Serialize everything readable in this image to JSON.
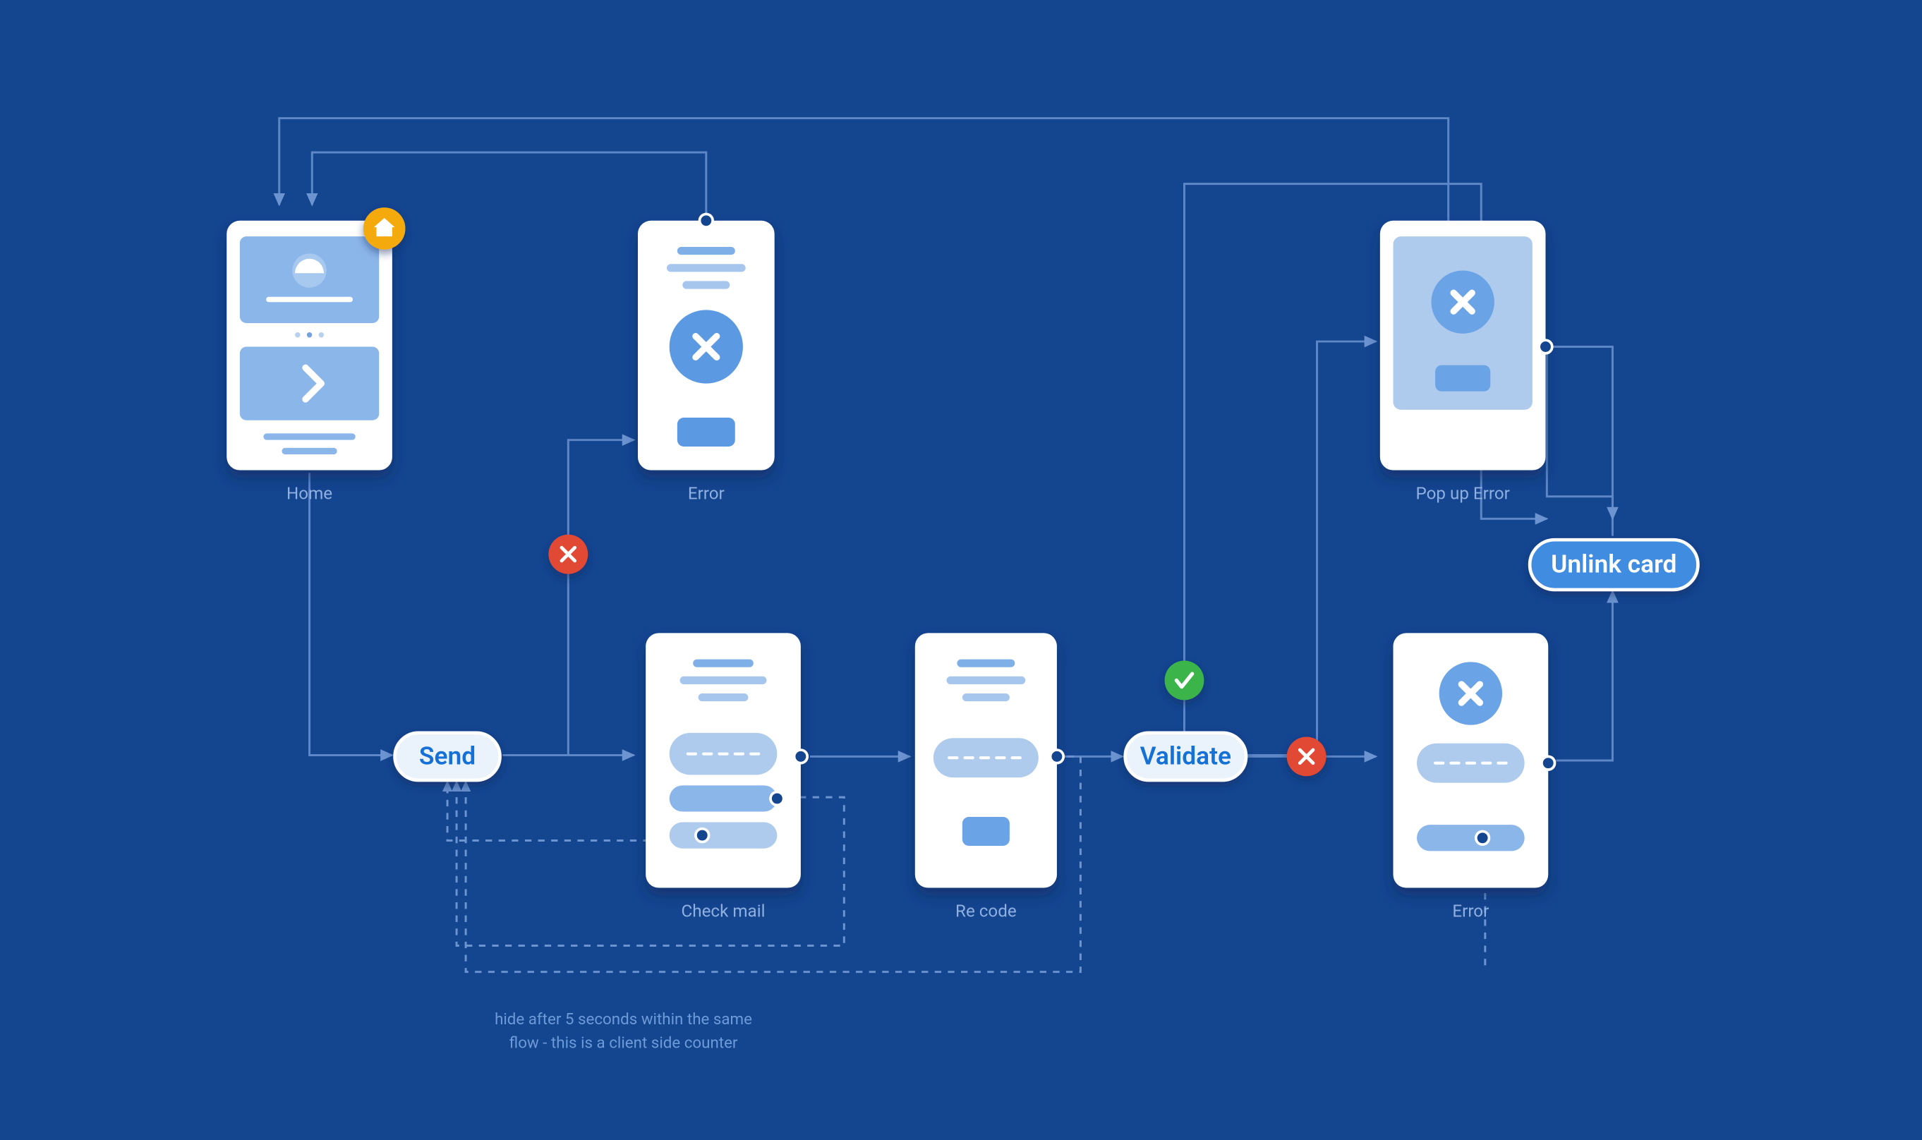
{
  "canvas": {
    "bg": "#14458f"
  },
  "palette": {
    "cardFill": "#ffffff",
    "cardAccent": "#6ba8ea",
    "cardAccentLight": "#a3c6ee",
    "cardAccentDark": "#4c93e2",
    "pillFill": "#eaf2fb",
    "pillBorder": "#ffffff",
    "pillAccent": "#1571d6",
    "pillSolid": "#3f8ce0",
    "badgeHome": "#f4a911",
    "badgeFail": "#e14a34",
    "badgeOk": "#3bb54a",
    "edge": "#4f7bc0",
    "edgeDash": "#5c88c8"
  },
  "screens": {
    "home": {
      "label": "Home"
    },
    "error_top": {
      "label": "Error"
    },
    "popup_error": {
      "label": "Pop up Error"
    },
    "check_mail": {
      "label": "Check mail"
    },
    "re_code": {
      "label": "Re code"
    },
    "error_bottom": {
      "label": "Error"
    }
  },
  "pills": {
    "send": {
      "label": "Send"
    },
    "validate": {
      "label": "Validate"
    },
    "unlink": {
      "label": "Unlink card"
    }
  },
  "note": {
    "line1": "hide after 5 seconds within the same",
    "line2": "flow - this is a client side counter"
  }
}
